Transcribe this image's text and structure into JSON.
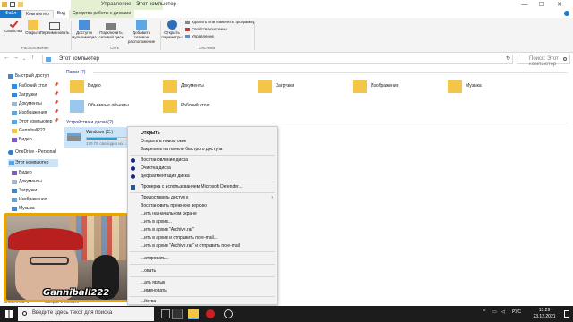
{
  "window": {
    "title": "Этот компьютер",
    "contextual_tab_group": "Управление",
    "minimize": "—",
    "maximize": "☐",
    "close": "✕"
  },
  "ribbon_tabs": [
    "Файл",
    "Компьютер",
    "Вид",
    "Средства работы с дисками"
  ],
  "ribbon": {
    "properties": "Свойства",
    "open": "Открыть",
    "rename": "Переименовать",
    "group_location": "Расположение",
    "media_access": "Доступ к мультимедиа",
    "map_drive": "Подключить сетевой диск",
    "add_location": "Добавить сетевое расположение",
    "group_network": "Сеть",
    "open_settings": "Открыть параметры",
    "uninstall": "Удалить или изменить программу",
    "system_props": "Свойства системы",
    "manage": "Управление",
    "group_system": "Система"
  },
  "address": {
    "path": "Этот компьютер",
    "search_placeholder": "Поиск: Этот компьютер"
  },
  "nav": {
    "quick_access": "Быстрый доступ",
    "pinned": [
      {
        "label": "Рабочий стол",
        "icon": "desktop-folder-icon"
      },
      {
        "label": "Загрузки",
        "icon": "downloads-folder-icon"
      },
      {
        "label": "Документы",
        "icon": "documents-folder-icon"
      },
      {
        "label": "Изображения",
        "icon": "pictures-folder-icon"
      },
      {
        "label": "Этот компьютер",
        "icon": "computer-icon"
      },
      {
        "label": "Ganniball222",
        "icon": "folder-icon"
      },
      {
        "label": "Видео",
        "icon": "videos-folder-icon"
      }
    ],
    "onedrive": "OneDrive - Personal",
    "this_pc": "Этот компьютер",
    "this_pc_children": [
      "Видео",
      "Документы",
      "Загрузки",
      "Изображения",
      "Музыка"
    ]
  },
  "content": {
    "folders_header": "Папки (7)",
    "folders": [
      {
        "name": "Видео",
        "icon": "videos-folder-icon"
      },
      {
        "name": "Документы",
        "icon": "documents-folder-icon"
      },
      {
        "name": "Загрузки",
        "icon": "downloads-folder-icon"
      },
      {
        "name": "Изображения",
        "icon": "pictures-folder-icon"
      },
      {
        "name": "Музыка",
        "icon": "music-folder-icon"
      },
      {
        "name": "Объемные объекты",
        "icon": "3d-objects-folder-icon"
      },
      {
        "name": "Рабочий стол",
        "icon": "desktop-folder-icon"
      }
    ],
    "devices_header": "Устройства и диски (2)",
    "drive": {
      "name": "Windows (C:)",
      "free": "170 ГБ свободно из ...",
      "used_fraction": 0.63
    }
  },
  "context_menu": {
    "items": [
      {
        "label": "Открыть",
        "bold": true,
        "icon": ""
      },
      {
        "label": "Открыть в новом окне",
        "icon": ""
      },
      {
        "label": "Закрепить на панели быстрого доступа",
        "icon": ""
      },
      {
        "label": "Восстановление диска",
        "icon": "disk-tool-icon"
      },
      {
        "label": "Очистка диска",
        "icon": "disk-tool-icon"
      },
      {
        "label": "Дефрагментация диска",
        "icon": "disk-tool-icon"
      },
      {
        "label": "Проверка с использованием Microsoft Defender...",
        "icon": "defender-icon"
      },
      {
        "label": "Предоставить доступ к",
        "icon": "",
        "submenu": "›"
      },
      {
        "label": "Восстановить прежнюю версию",
        "icon": ""
      },
      {
        "label": "...ить на начальном экране",
        "icon": ""
      },
      {
        "label": "...ить в архив...",
        "icon": ""
      },
      {
        "label": "...ить в архив \"Archive.rar\"",
        "icon": ""
      },
      {
        "label": "...ить в архив и отправить по e-mail...",
        "icon": ""
      },
      {
        "label": "...ить в архив \"Archive.rar\" и отправить по e-mail",
        "icon": ""
      },
      {
        "label": "...атировать...",
        "icon": ""
      },
      {
        "label": "...овать",
        "icon": ""
      },
      {
        "label": "...ать ярлык",
        "icon": ""
      },
      {
        "label": "...именовать",
        "icon": ""
      },
      {
        "label": "...йства",
        "icon": ""
      }
    ]
  },
  "status": {
    "count": "Элементов: 9",
    "selected": "Выбран 1 элемент"
  },
  "webcam": {
    "name": "Ganniball222"
  },
  "taskbar": {
    "search_placeholder": "Введите здесь текст для поиска",
    "lang": "РУС",
    "time": "13:29",
    "date": "23.12.2021"
  },
  "colors": {
    "accent": "#1979ca",
    "selection": "#cce4f7",
    "folder": "#f3c548",
    "taskbar": "#1c1c1c"
  }
}
